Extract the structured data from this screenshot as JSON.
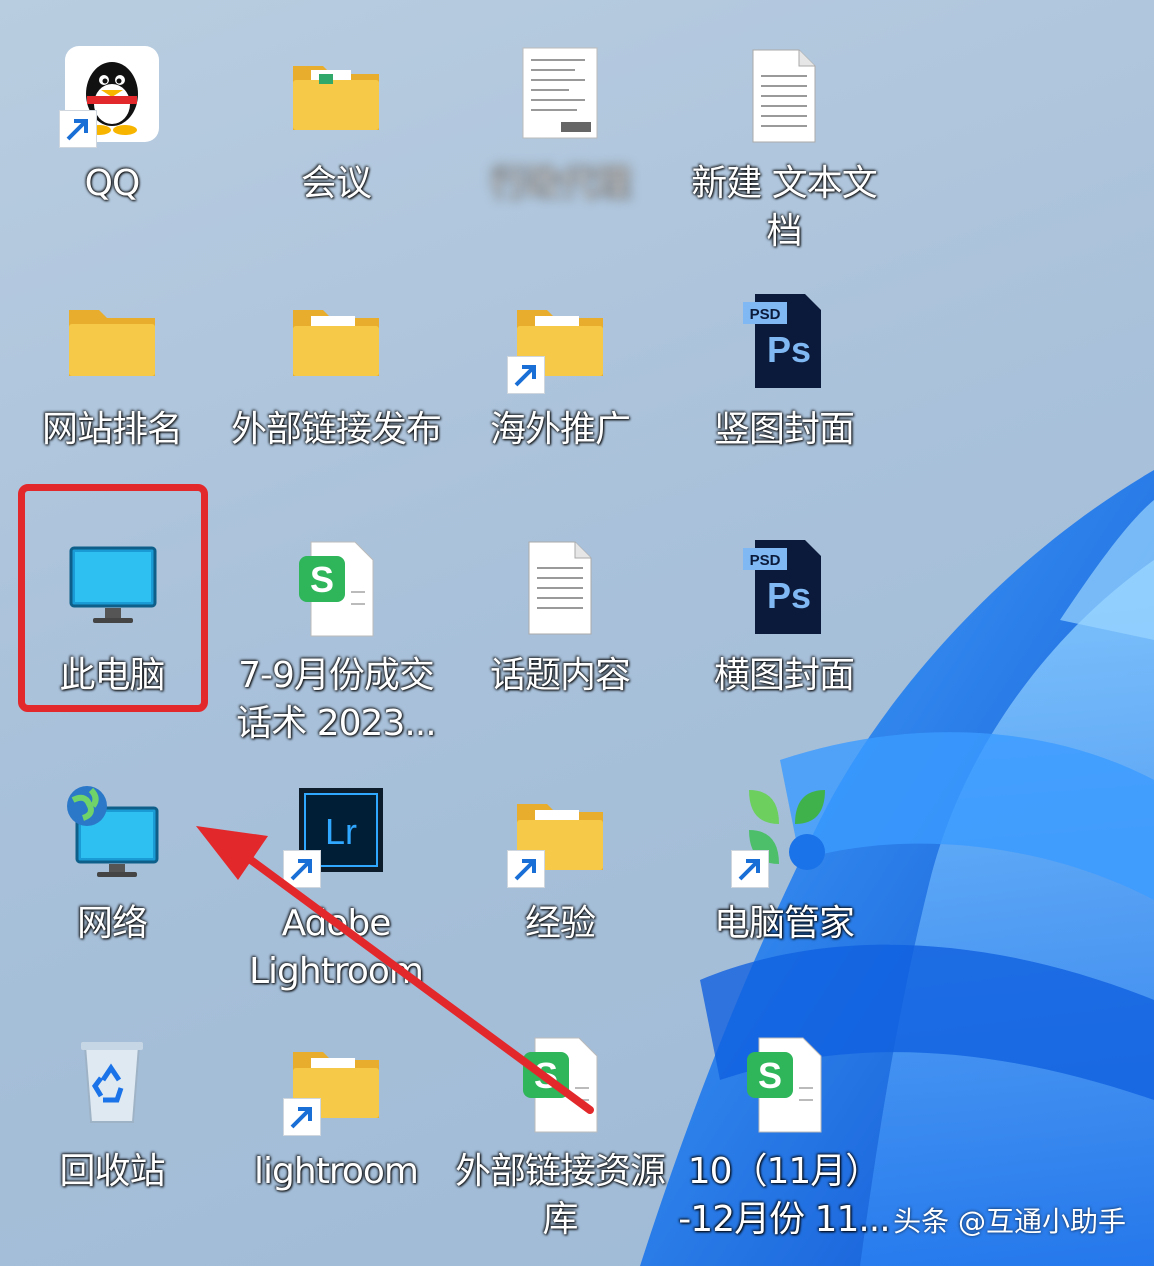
{
  "desktop": {
    "icons": [
      {
        "label": "QQ"
      },
      {
        "label": "会议"
      },
      {
        "label": "行政代理"
      },
      {
        "label": "新建 文本文\n档"
      },
      {
        "label": "网站排名"
      },
      {
        "label": "外部链接发布"
      },
      {
        "label": "海外推广"
      },
      {
        "label": "竖图封面"
      },
      {
        "label": "此电脑"
      },
      {
        "label": "7-9月份成交\n话术 2023..."
      },
      {
        "label": "话题内容"
      },
      {
        "label": "横图封面"
      },
      {
        "label": "网络"
      },
      {
        "label": "Adobe\nLightroom"
      },
      {
        "label": "经验"
      },
      {
        "label": "电脑管家"
      },
      {
        "label": "回收站"
      },
      {
        "label": "lightroom"
      },
      {
        "label": "外部链接资源\n库"
      },
      {
        "label": "10（11月）\n-12月份 11..."
      }
    ],
    "psd_badge": "PSD",
    "ps_text": "Ps",
    "sheet_letter": "S",
    "lr_text": "Lr"
  },
  "annotation": {
    "highlight_color": "#e3282c",
    "arrow_color": "#e3282c"
  },
  "watermark": "头条 @互通小助手",
  "colors": {
    "folder": "#f5c542",
    "wallpaper_blue": "#1a6fe0"
  }
}
